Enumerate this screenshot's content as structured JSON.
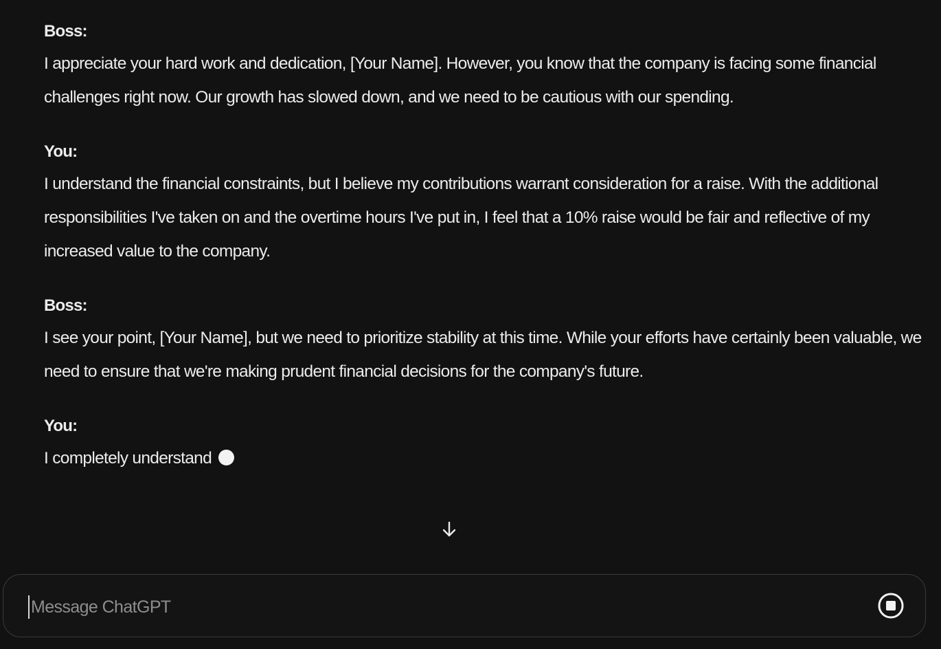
{
  "conversation": [
    {
      "speaker": "Boss:",
      "text": "I appreciate your hard work and dedication, [Your Name]. However, you know that the company is facing some financial challenges right now. Our growth has slowed down, and we need to be cautious with our spending."
    },
    {
      "speaker": "You:",
      "text": "I understand the financial constraints, but I believe my contributions warrant consideration for a raise. With the additional responsibilities I've taken on and the overtime hours I've put in, I feel that a 10% raise would be fair and reflective of my increased value to the company."
    },
    {
      "speaker": "Boss:",
      "text": "I see your point, [Your Name], but we need to prioritize stability at this time. While your efforts have certainly been valuable, we need to ensure that we're making prudent financial decisions for the company's future."
    },
    {
      "speaker": "You:",
      "text": "I completely understand"
    }
  ],
  "composer": {
    "placeholder": "Message ChatGPT",
    "value": ""
  },
  "icons": {
    "scroll": "arrow-down-icon",
    "stop": "stop-generating-icon",
    "streaming": "streaming-dot-icon"
  },
  "colors": {
    "background": "#121212",
    "text": "#ececec",
    "placeholder": "#8e8e8e",
    "border": "#3a3a3a"
  }
}
